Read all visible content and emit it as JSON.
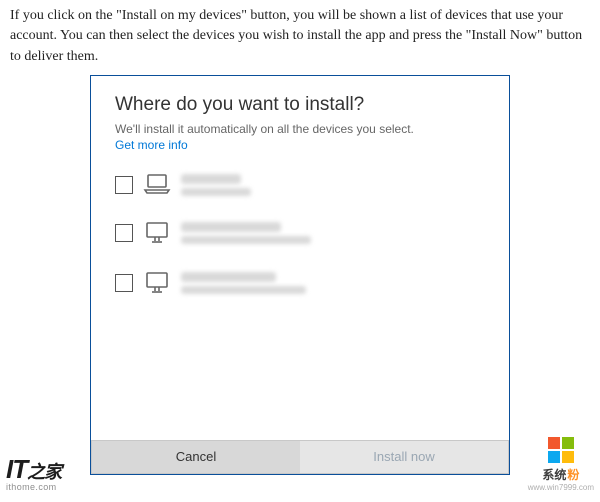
{
  "article": {
    "paragraph": "If you click on the \"Install on my devices\" button, you will be shown a list of devices that use your account. You can then select the devices you wish to install the app and press the \"Install Now\" button to deliver them."
  },
  "dialog": {
    "title": "Where do you want to install?",
    "subtitle": "We'll install it automatically on all the devices you select.",
    "link": "Get more info",
    "devices": [
      {
        "icon": "laptop"
      },
      {
        "icon": "desktop"
      },
      {
        "icon": "desktop"
      }
    ],
    "cancel": "Cancel",
    "install": "Install now"
  },
  "watermark_left": {
    "logo_text": "IT",
    "domain": "ithome.com"
  },
  "watermark_right": {
    "label_a": "系统",
    "label_accent": "粉",
    "domain": "www.win7999.com"
  }
}
